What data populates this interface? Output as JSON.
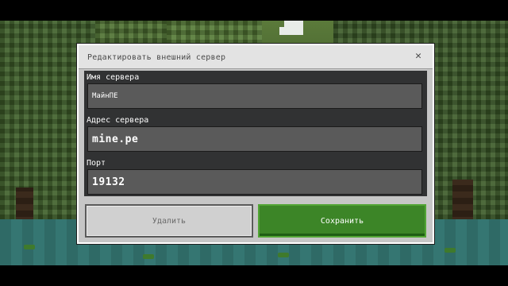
{
  "dialog": {
    "title": "Редактировать внешний сервер",
    "close_glyph": "✕"
  },
  "fields": {
    "server_name": {
      "label": "Имя сервера",
      "value": "МайнПЕ"
    },
    "server_address": {
      "label": "Адрес сервера",
      "value": "mine.pe"
    },
    "port": {
      "label": "Порт",
      "value": "19132"
    }
  },
  "buttons": {
    "delete_label": "Удалить",
    "save_label": "Сохранить"
  },
  "colors": {
    "save_green": "#3c8527",
    "dialog_gray": "#c6c6c6",
    "form_dark": "#313233"
  }
}
